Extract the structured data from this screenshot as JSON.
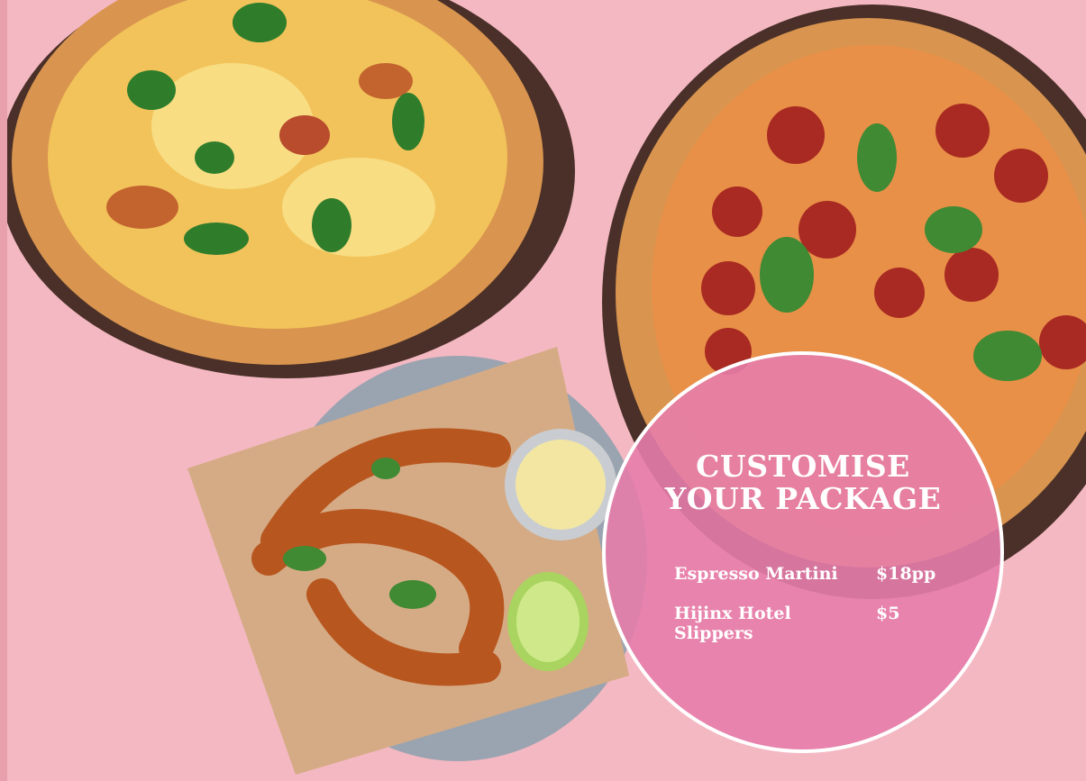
{
  "promo": {
    "heading_line1": "CUSTOMISE",
    "heading_line2": "YOUR PACKAGE",
    "items": [
      {
        "name": "Espresso Martini",
        "price": "$18pp"
      },
      {
        "name": "Hijinx Hotel Slippers",
        "price": "$5"
      }
    ]
  },
  "colors": {
    "background": "#f4b8c2",
    "circle_fill": "#e67daa",
    "text": "#ffffff"
  }
}
